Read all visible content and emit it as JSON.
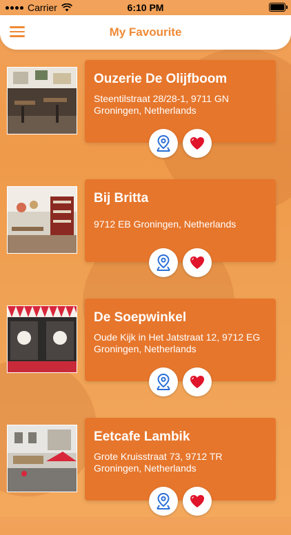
{
  "status_bar": {
    "carrier": "Carrier",
    "time": "6:10 PM"
  },
  "header": {
    "title": "My Favourite"
  },
  "colors": {
    "accent": "#ef8a36",
    "card": "#e6762c",
    "heart": "#e0142a",
    "map_pin": "#2a6fd6"
  },
  "favourites": [
    {
      "name": "Ouzerie De Olijfboom",
      "address": "Steentilstraat 28/28-1, 9711 GN Groningen, Netherlands"
    },
    {
      "name": "Bij Britta",
      "address": "9712 EB Groningen, Netherlands"
    },
    {
      "name": "De Soepwinkel",
      "address": "Oude Kijk in Het Jatstraat 12, 9712 EG Groningen, Netherlands"
    },
    {
      "name": "Eetcafe Lambik",
      "address": "Grote Kruisstraat 73, 9712 TR Groningen, Netherlands"
    }
  ]
}
